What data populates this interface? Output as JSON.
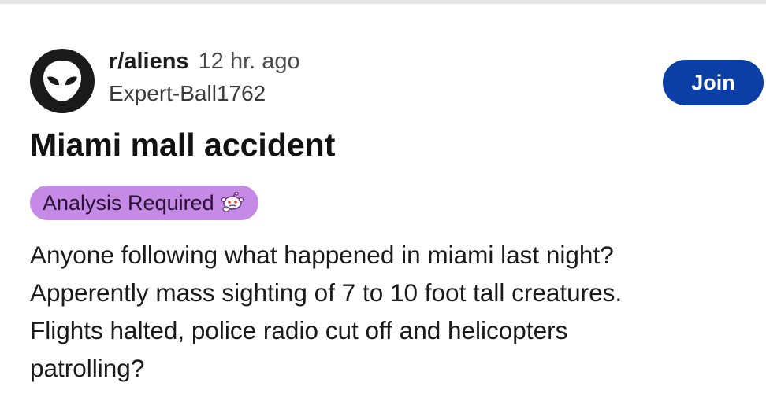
{
  "post": {
    "subreddit": "r/aliens",
    "time_ago": "12 hr. ago",
    "author": "Expert-Ball1762",
    "join_label": "Join",
    "title": "Miami mall accident",
    "flair": "Analysis Required",
    "body_lines": [
      "Anyone following what happened in miami last night?",
      "Apperently mass sighting of 7 to 10 foot tall creatures.",
      "Flights halted, police radio cut off and helicopters",
      "patrolling?"
    ]
  },
  "icons": {
    "avatar": "alien-head-icon",
    "flair": "snoo-thinking-icon"
  },
  "colors": {
    "join_button": "#0b3fa6",
    "flair_background": "#c58ae6",
    "avatar_background": "#1a1a1a"
  }
}
